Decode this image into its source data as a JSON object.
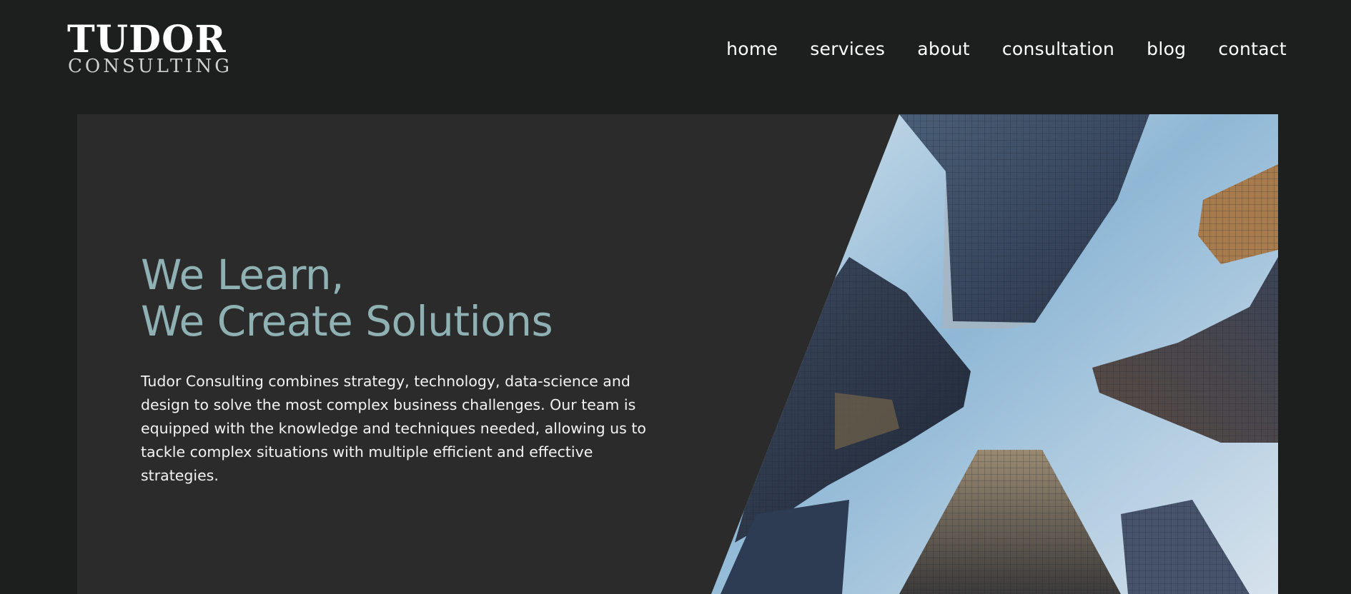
{
  "header": {
    "logo": {
      "main": "TUDOR",
      "sub": "CONSULTING"
    },
    "nav": [
      {
        "label": "home"
      },
      {
        "label": "services"
      },
      {
        "label": "about"
      },
      {
        "label": "consultation"
      },
      {
        "label": "blog"
      },
      {
        "label": "contact"
      }
    ]
  },
  "hero": {
    "headline_line1": "We Learn,",
    "headline_line2": "We Create Solutions",
    "description": "Tudor Consulting combines strategy, technology, data-science and design to solve the most complex business challenges. Our team is equipped with the knowledge and techniques needed, allowing us to tackle complex situations with multiple efficient and effective strategies.",
    "image_subject": "skyscrapers-looking-up"
  },
  "colors": {
    "page_background": "#1d1e1e",
    "hero_background": "#2b2b2b",
    "headline": "#8fb1b3",
    "text": "#ffffff"
  }
}
